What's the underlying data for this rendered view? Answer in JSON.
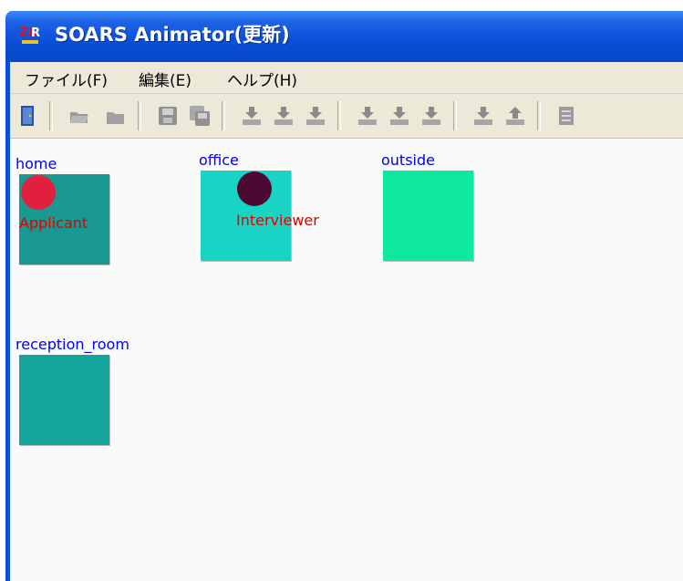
{
  "window": {
    "title": "SOARS Animator(更新)",
    "icon": "soars-logo-icon",
    "colors": {
      "titlebar": "#0a50da",
      "frame": "#0a4fd8",
      "chrome": "#ece9d8"
    }
  },
  "menu": {
    "items": [
      {
        "label": "ファイル(F)"
      },
      {
        "label": "編集(E)"
      },
      {
        "label": "ヘルプ(H)"
      }
    ]
  },
  "toolbar": {
    "buttons": [
      {
        "icon": "exit-door-icon",
        "enabled": true
      },
      {
        "icon": "open-folder-icon",
        "enabled": false
      },
      {
        "icon": "folder-icon",
        "enabled": false
      },
      {
        "icon": "save-icon",
        "enabled": false
      },
      {
        "icon": "save-as-icon",
        "enabled": false
      },
      {
        "icon": "import-icon",
        "enabled": false
      },
      {
        "icon": "import-icon",
        "enabled": false
      },
      {
        "icon": "import-icon",
        "enabled": false
      },
      {
        "icon": "import-icon",
        "enabled": false
      },
      {
        "icon": "import-icon",
        "enabled": false
      },
      {
        "icon": "import-icon",
        "enabled": false
      },
      {
        "icon": "import-icon",
        "enabled": false
      },
      {
        "icon": "export-icon",
        "enabled": false
      },
      {
        "icon": "document-icon",
        "enabled": false
      }
    ]
  },
  "spots": [
    {
      "name": "home",
      "color": "#189890"
    },
    {
      "name": "office",
      "color": "#17d4c4"
    },
    {
      "name": "outside",
      "color": "#0fe8a0"
    },
    {
      "name": "reception_room",
      "color": "#13a49c"
    }
  ],
  "agents": [
    {
      "name": "Applicant",
      "spot": "home",
      "color": "#e0203c"
    },
    {
      "name": "Interviewer",
      "spot": "office",
      "color": "#4a0a32"
    }
  ],
  "label_colors": {
    "spot": "#0000ee",
    "agent": "#e00000"
  }
}
